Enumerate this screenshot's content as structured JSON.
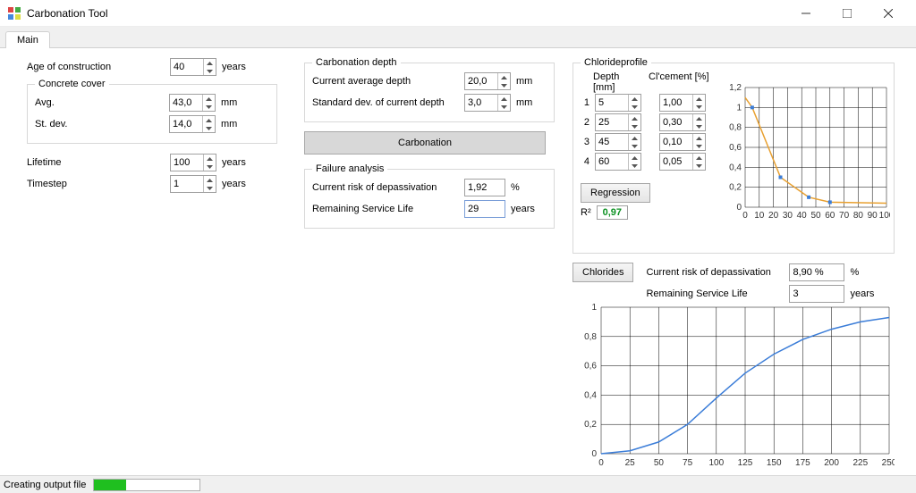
{
  "window": {
    "title": "Carbonation Tool"
  },
  "tabs": {
    "main": "Main"
  },
  "left": {
    "age_label": "Age of construction",
    "age_value": "40",
    "age_unit": "years",
    "cover_legend": "Concrete cover",
    "avg_label": "Avg.",
    "avg_value": "43,0",
    "avg_unit": "mm",
    "std_label": "St. dev.",
    "std_value": "14,0",
    "std_unit": "mm",
    "lifetime_label": "Lifetime",
    "lifetime_value": "100",
    "lifetime_unit": "years",
    "timestep_label": "Timestep",
    "timestep_value": "1",
    "timestep_unit": "years"
  },
  "carb": {
    "legend": "Carbonation depth",
    "avg_label": "Current average depth",
    "avg_value": "20,0",
    "avg_unit": "mm",
    "std_label": "Standard dev. of current depth",
    "std_value": "3,0",
    "std_unit": "mm",
    "button": "Carbonation"
  },
  "fail": {
    "legend": "Failure analysis",
    "risk_label": "Current risk of depassivation",
    "risk_value": "1,92",
    "risk_unit": "%",
    "rsl_label": "Remaining Service Life",
    "rsl_value": "29",
    "rsl_unit": "years"
  },
  "chl": {
    "legend": "Chlorideprofile",
    "depth_header": "Depth [mm]",
    "cement_header": "Cl'cement [%]",
    "rows": [
      {
        "idx": "1",
        "depth": "5",
        "val": "1,00"
      },
      {
        "idx": "2",
        "depth": "25",
        "val": "0,30"
      },
      {
        "idx": "3",
        "depth": "45",
        "val": "0,10"
      },
      {
        "idx": "4",
        "depth": "60",
        "val": "0,05"
      }
    ],
    "regression_btn": "Regression",
    "r2_label": "R²",
    "r2_value": "0,97",
    "chlorides_btn": "Chlorides",
    "risk_label": "Current risk of depassivation",
    "risk_value": "8,90 %",
    "risk_unit": "%",
    "rsl_label": "Remaining Service Life",
    "rsl_value": "3",
    "rsl_unit": "years"
  },
  "status": {
    "text": "Creating output file"
  },
  "chart_data": [
    {
      "type": "scatter+line",
      "title": "",
      "xlabel": "",
      "ylabel": "",
      "xlim": [
        0,
        100
      ],
      "ylim": [
        0,
        1.2
      ],
      "xticks": [
        0,
        10,
        20,
        30,
        40,
        50,
        60,
        70,
        80,
        90,
        100
      ],
      "yticks": [
        0,
        0.2,
        0.4,
        0.6,
        0.8,
        1,
        1.2
      ],
      "points": [
        {
          "x": 5,
          "y": 1.0
        },
        {
          "x": 25,
          "y": 0.3
        },
        {
          "x": 45,
          "y": 0.1
        },
        {
          "x": 60,
          "y": 0.05
        }
      ],
      "fit_line": [
        {
          "x": 0,
          "y": 1.1
        },
        {
          "x": 5,
          "y": 1.0
        },
        {
          "x": 25,
          "y": 0.3
        },
        {
          "x": 45,
          "y": 0.1
        },
        {
          "x": 60,
          "y": 0.05
        },
        {
          "x": 100,
          "y": 0.04
        }
      ]
    },
    {
      "type": "line",
      "title": "",
      "xlabel": "",
      "ylabel": "",
      "xlim": [
        0,
        250
      ],
      "ylim": [
        0,
        1
      ],
      "xticks": [
        0,
        25,
        50,
        75,
        100,
        125,
        150,
        175,
        200,
        225,
        250
      ],
      "yticks": [
        0,
        0.2,
        0.4,
        0.6,
        0.8,
        1
      ],
      "series": [
        {
          "name": "",
          "points": [
            {
              "x": 0,
              "y": 0.0
            },
            {
              "x": 25,
              "y": 0.02
            },
            {
              "x": 50,
              "y": 0.08
            },
            {
              "x": 75,
              "y": 0.2
            },
            {
              "x": 100,
              "y": 0.38
            },
            {
              "x": 125,
              "y": 0.55
            },
            {
              "x": 150,
              "y": 0.68
            },
            {
              "x": 175,
              "y": 0.78
            },
            {
              "x": 200,
              "y": 0.85
            },
            {
              "x": 225,
              "y": 0.9
            },
            {
              "x": 250,
              "y": 0.93
            }
          ]
        }
      ]
    }
  ]
}
